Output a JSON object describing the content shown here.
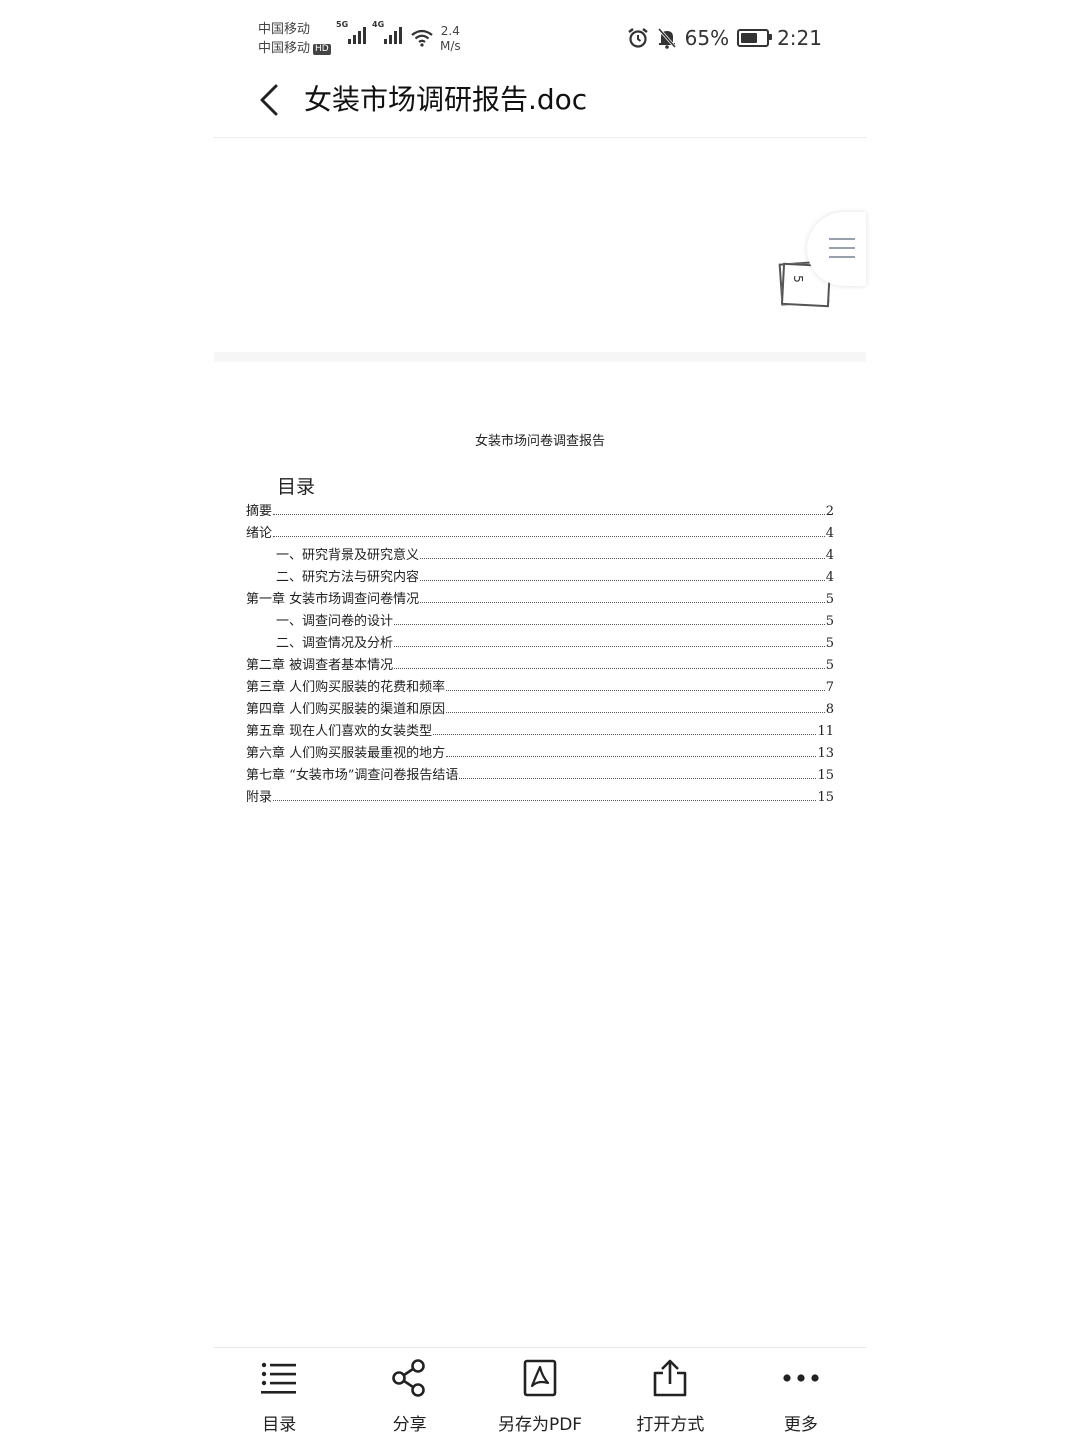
{
  "status_bar": {
    "carrier1": "中国移动",
    "carrier2": "中国移动",
    "hd_badge": "HD",
    "sig1_label": "5G",
    "sig2_label": "4G",
    "speed_value": "2.4",
    "speed_unit": "M/s",
    "battery_text": "65%",
    "battery_level": 0.65,
    "time": "2:21"
  },
  "header": {
    "title": "女装市场调研报告.doc"
  },
  "page_indicator": {
    "page": "5"
  },
  "document": {
    "title": "女装市场问卷调查报告",
    "toc_heading": "目录",
    "toc": [
      {
        "label": "摘要",
        "page": "2",
        "indent": false
      },
      {
        "label": "绪论",
        "page": "4",
        "indent": false
      },
      {
        "label": "一、研究背景及研究意义",
        "page": "4",
        "indent": true
      },
      {
        "label": "二、研究方法与研究内容",
        "page": "4",
        "indent": true
      },
      {
        "label": "第一章 女装市场调查问卷情况",
        "page": "5",
        "indent": false
      },
      {
        "label": "一、调查问卷的设计",
        "page": "5",
        "indent": true
      },
      {
        "label": "二、调查情况及分析",
        "page": "5",
        "indent": true
      },
      {
        "label": "第二章 被调查者基本情况",
        "page": "5",
        "indent": false
      },
      {
        "label": "第三章 人们购买服装的花费和频率",
        "page": "7",
        "indent": false
      },
      {
        "label": "第四章 人们购买服装的渠道和原因",
        "page": "8",
        "indent": false
      },
      {
        "label": "第五章 现在人们喜欢的女装类型",
        "page": "11",
        "indent": false
      },
      {
        "label": "第六章 人们购买服装最重视的地方",
        "page": "13",
        "indent": false
      },
      {
        "label": "第七章 “女装市场”调查问卷报告结语",
        "page": "15",
        "indent": false
      },
      {
        "label": "附录",
        "page": "15",
        "indent": false
      }
    ]
  },
  "toolbar": {
    "items": [
      {
        "label": "目录",
        "icon": "list-icon"
      },
      {
        "label": "分享",
        "icon": "share-icon"
      },
      {
        "label": "另存为PDF",
        "icon": "pdf-icon"
      },
      {
        "label": "打开方式",
        "icon": "upload-icon"
      },
      {
        "label": "更多",
        "icon": "more-icon"
      }
    ]
  }
}
